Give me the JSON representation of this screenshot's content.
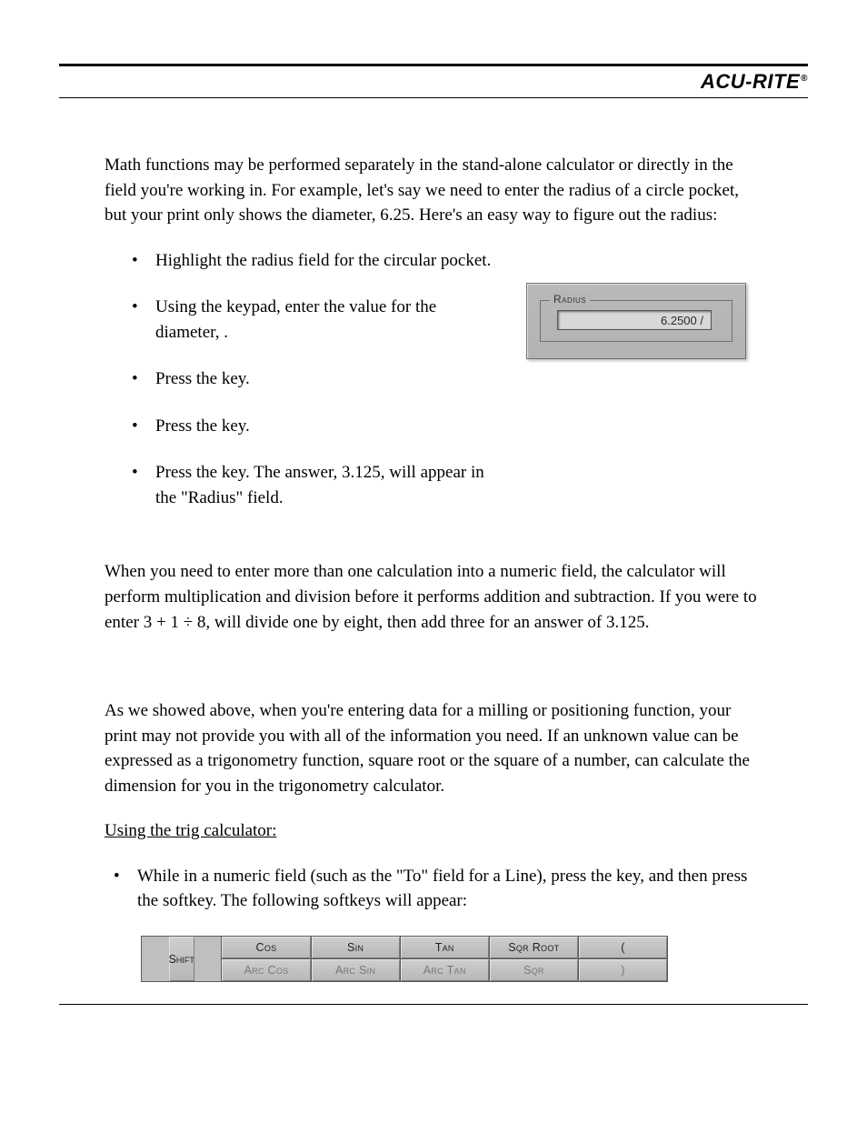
{
  "brand": {
    "name": "ACU-RITE",
    "reg": "®"
  },
  "intro": "Math functions may be performed separately in the stand-alone calculator or directly in the field you're working in. For example, let's say we need to enter the radius of a circle pocket, but your print only shows the diameter, 6.25. Here's an easy way to figure out the radius:",
  "steps": {
    "s1": "Highlight the radius field for the circular pocket.",
    "s2a": "Using the keypad, enter the value for the diameter, ",
    "s2b": ".",
    "s3a": "Press the ",
    "s3b": " key.",
    "s4a": "Press the ",
    "s4b": " key.",
    "s5a": "Press the ",
    "s5b": " key. The answer, 3.125, will appear in the \"Radius\" field."
  },
  "radius_panel": {
    "label": "Radius",
    "value": "6.2500 /"
  },
  "order_para_a": "When you need to enter more than one calculation into a numeric field, the calculator will perform multiplication and division before it performs addition and subtraction. If you were to enter 3 + 1 ÷ 8, ",
  "order_para_b": " will divide one by eight, then add three for an answer of 3.125.",
  "trig_para_a": "As we showed above, when you're entering data for a milling or positioning function, your print may not provide you with all of the information you need. If an unknown value can be expressed as a trigonometry function, square root or the square of a number, ",
  "trig_para_b": " can calculate the dimension for you in the trigonometry calculator.",
  "trig_heading": "Using the trig calculator:",
  "trig_step_a": "While in a numeric field (such as the \"To\" field for a Line), press the ",
  "trig_step_b": " key, and then press the ",
  "trig_step_c": " softkey. The following softkeys will appear:",
  "softkeys": {
    "shift": "Shift",
    "c1": {
      "top": "Cos",
      "bot": "Arc Cos"
    },
    "c2": {
      "top": "Sin",
      "bot": "Arc Sin"
    },
    "c3": {
      "top": "Tan",
      "bot": "Arc Tan"
    },
    "c4": {
      "top": "Sqr Root",
      "bot": "Sqr"
    },
    "c5": {
      "top": "(",
      "bot": ")"
    }
  }
}
